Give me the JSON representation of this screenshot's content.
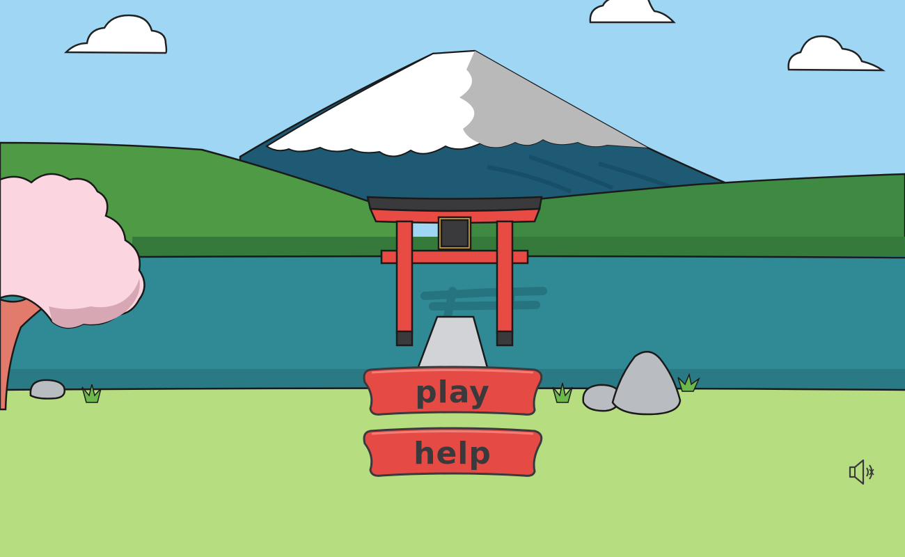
{
  "menu": {
    "play_label": "play",
    "help_label": "help"
  },
  "controls": {
    "sound_icon": "speaker-sound-on-icon"
  },
  "colors": {
    "sky": "#9fd6f3",
    "grass_front": "#b6dd7f",
    "lake": "#2f8a96",
    "torii_red": "#e74b44",
    "button_red": "#e64a45",
    "mountain_snow": "#ffffff",
    "mountain_base": "#1f5a75",
    "hills": "#4f9a44",
    "cherry_blossom": "#fbd5df"
  }
}
